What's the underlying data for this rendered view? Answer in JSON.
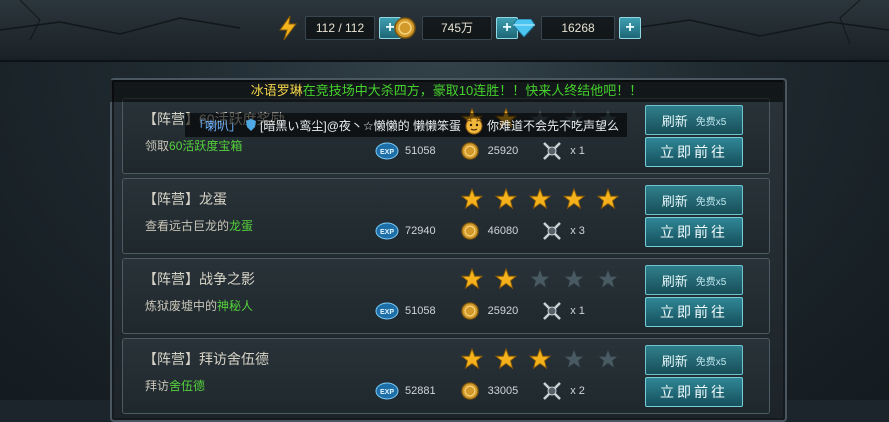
{
  "resources": {
    "stamina": "112 / 112",
    "gold": "745万",
    "gems": "16268",
    "plus": "+"
  },
  "broadcast": {
    "prefix": "冰语罗琳",
    "text": "在竞技场中大杀四方，豪取10连胜！！快来人终结他吧！！"
  },
  "chat": {
    "channel": "「喇叭」",
    "sender": "[暗黑い鸾尘]",
    "message": "@夜丶☆懒懒的 懒懒笨蛋",
    "message_tail": "你难道不会先不吃声望么"
  },
  "buttons": {
    "refresh": "刷新",
    "refresh_free": "免费x5",
    "go": "立即前往"
  },
  "quests": [
    {
      "title": "【阵营】60活跃度奖励",
      "desc_prefix": "领取",
      "desc_highlight": "60活跃度宝箱",
      "desc_suffix": "",
      "stars": 2,
      "exp": "51058",
      "coins": "25920",
      "item": "x 1"
    },
    {
      "title": "【阵营】龙蛋",
      "desc_prefix": "查看远古巨龙的",
      "desc_highlight": "龙蛋",
      "desc_suffix": "",
      "stars": 5,
      "exp": "72940",
      "coins": "46080",
      "item": "x 3"
    },
    {
      "title": "【阵营】战争之影",
      "desc_prefix": "炼狱废墟中的",
      "desc_highlight": "神秘人",
      "desc_suffix": "",
      "stars": 2,
      "exp": "51058",
      "coins": "25920",
      "item": "x 1"
    },
    {
      "title": "【阵营】拜访舍伍德",
      "desc_prefix": "拜访",
      "desc_highlight": "舍伍德",
      "desc_suffix": "",
      "stars": 3,
      "exp": "52881",
      "coins": "33005",
      "item": "x 2"
    }
  ],
  "exp_label": "EXP",
  "colors": {
    "highlight": "#55d13c",
    "star_on": "#f3b21c",
    "star_off": "#4a5a63",
    "button": "#2f7f8c"
  }
}
